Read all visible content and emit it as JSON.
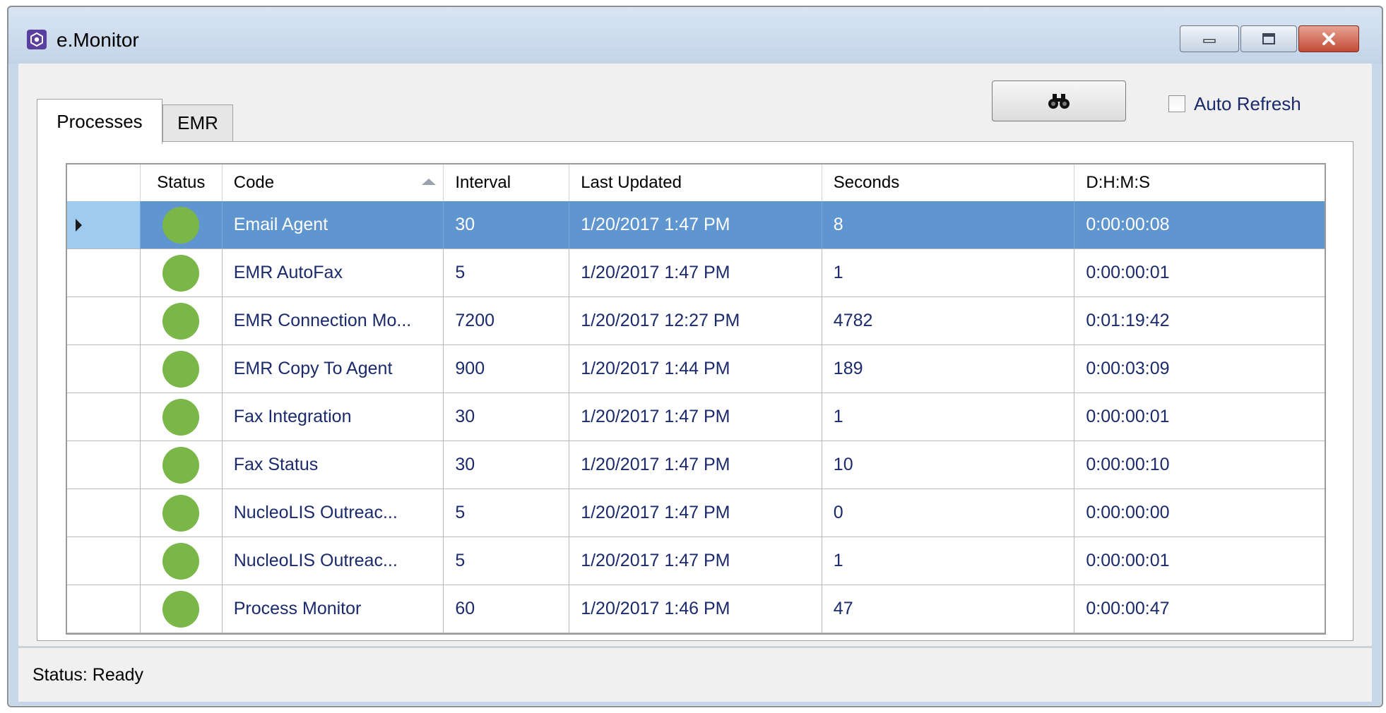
{
  "window": {
    "title": "e.Monitor",
    "icon": "emonitor-app-icon",
    "controls": [
      "minimize-icon",
      "maximize-icon",
      "close-icon"
    ]
  },
  "tabs": [
    {
      "label": "Processes",
      "active": true
    },
    {
      "label": "EMR",
      "active": false
    }
  ],
  "toolbar": {
    "find_icon": "binoculars-icon",
    "auto_refresh_label": "Auto Refresh",
    "auto_refresh_checked": false
  },
  "grid": {
    "columns": [
      "",
      "Status",
      "Code",
      "Interval",
      "Last Updated",
      "Seconds",
      "D:H:M:S"
    ],
    "sorted_column": "Code",
    "sort_direction": "ascending",
    "rows": [
      {
        "status": "green",
        "code": "Email Agent",
        "interval": "30",
        "last_updated": "1/20/2017 1:47 PM",
        "seconds": "8",
        "dhms": "0:00:00:08",
        "selected": true
      },
      {
        "status": "green",
        "code": "EMR AutoFax",
        "interval": "5",
        "last_updated": "1/20/2017 1:47 PM",
        "seconds": "1",
        "dhms": "0:00:00:01",
        "selected": false
      },
      {
        "status": "green",
        "code": "EMR Connection Mo...",
        "interval": "7200",
        "last_updated": "1/20/2017 12:27 PM",
        "seconds": "4782",
        "dhms": "0:01:19:42",
        "selected": false
      },
      {
        "status": "green",
        "code": "EMR Copy To Agent",
        "interval": "900",
        "last_updated": "1/20/2017 1:44 PM",
        "seconds": "189",
        "dhms": "0:00:03:09",
        "selected": false
      },
      {
        "status": "green",
        "code": "Fax Integration",
        "interval": "30",
        "last_updated": "1/20/2017 1:47 PM",
        "seconds": "1",
        "dhms": "0:00:00:01",
        "selected": false
      },
      {
        "status": "green",
        "code": "Fax Status",
        "interval": "30",
        "last_updated": "1/20/2017 1:47 PM",
        "seconds": "10",
        "dhms": "0:00:00:10",
        "selected": false
      },
      {
        "status": "green",
        "code": "NucleoLIS Outreac...",
        "interval": "5",
        "last_updated": "1/20/2017 1:47 PM",
        "seconds": "0",
        "dhms": "0:00:00:00",
        "selected": false
      },
      {
        "status": "green",
        "code": "NucleoLIS Outreac...",
        "interval": "5",
        "last_updated": "1/20/2017 1:47 PM",
        "seconds": "1",
        "dhms": "0:00:00:01",
        "selected": false
      },
      {
        "status": "green",
        "code": "Process Monitor",
        "interval": "60",
        "last_updated": "1/20/2017 1:46 PM",
        "seconds": "47",
        "dhms": "0:00:00:47",
        "selected": false
      }
    ]
  },
  "statusbar": {
    "text": "Status: Ready"
  },
  "colors": {
    "status_green": "#7ab648",
    "selection": "#6096cf",
    "text": "#1b2a6b"
  }
}
